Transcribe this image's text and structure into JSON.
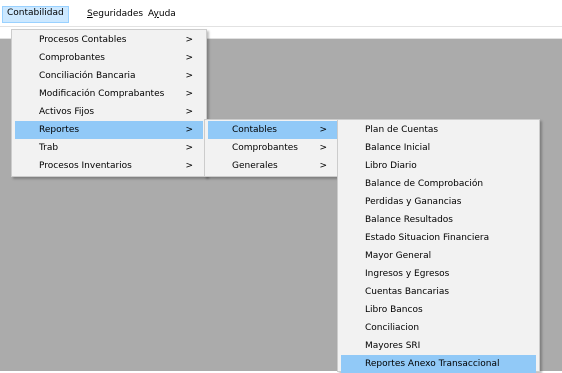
{
  "menubar": {
    "items": [
      {
        "label": "Contabilidad"
      },
      {
        "label_u": "S",
        "label_rest": "eguridades"
      },
      {
        "label_pre": "A",
        "label_u": "y",
        "label_rest": "uda"
      }
    ]
  },
  "menu1": {
    "items": [
      {
        "label": "Procesos Contables",
        "arrow": ">"
      },
      {
        "label": "Comprobantes",
        "arrow": ">"
      },
      {
        "label": "Conciliación Bancaria",
        "arrow": ">"
      },
      {
        "label": "Modificación Comprabantes",
        "arrow": ">"
      },
      {
        "label": "Activos Fijos",
        "arrow": ">"
      },
      {
        "label": "Reportes",
        "arrow": ">"
      },
      {
        "label": "Trab",
        "arrow": ">"
      },
      {
        "label": "Procesos Inventarios",
        "arrow": ">"
      }
    ]
  },
  "menu2": {
    "items": [
      {
        "label": "Contables",
        "arrow": ">"
      },
      {
        "label": "Comprobantes",
        "arrow": ">"
      },
      {
        "label": "Generales",
        "arrow": ">"
      }
    ]
  },
  "menu3": {
    "items": [
      {
        "label": "Plan de Cuentas"
      },
      {
        "label": "Balance Inicial"
      },
      {
        "label": "Libro Diario"
      },
      {
        "label": "Balance de Comprobación"
      },
      {
        "label": "Perdidas y Ganancias"
      },
      {
        "label": "Balance Resultados"
      },
      {
        "label": "Estado Situacion Financiera"
      },
      {
        "label": "Mayor General"
      },
      {
        "label": "Ingresos y Egresos"
      },
      {
        "label": "Cuentas Bancarias"
      },
      {
        "label": "Libro Bancos"
      },
      {
        "label": "Conciliacion"
      },
      {
        "label": "Mayores SRI"
      },
      {
        "label": "Reportes Anexo Transaccional"
      }
    ]
  }
}
